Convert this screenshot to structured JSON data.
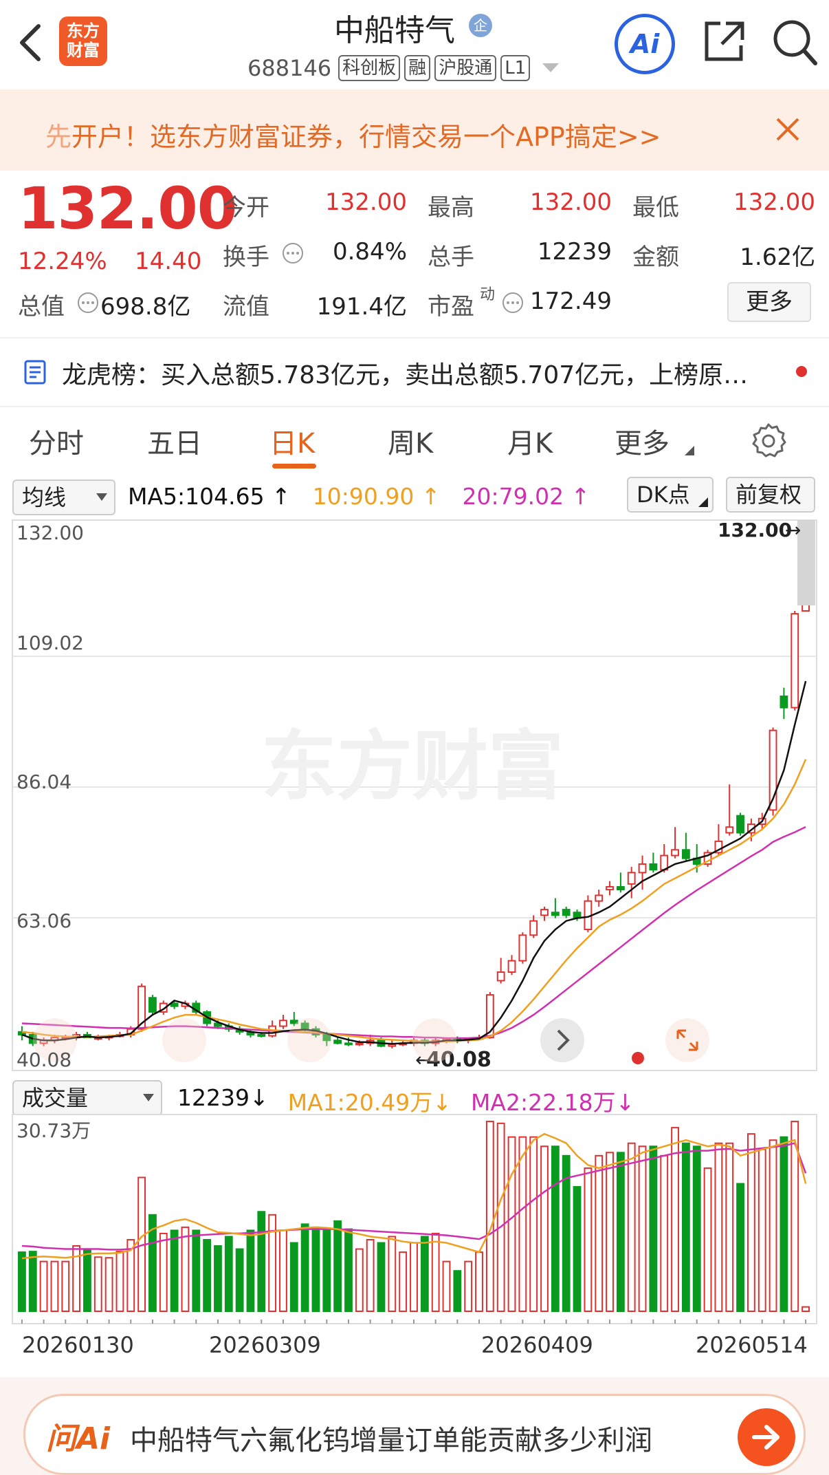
{
  "header": {
    "stock_name": "中船特气",
    "enterprise_badge": "企",
    "code": "688146",
    "tags": [
      "科创板",
      "融",
      "沪股通",
      "L1"
    ],
    "logo_line1": "东方",
    "logo_line2": "财富",
    "ai_button": "Ai"
  },
  "banner": {
    "first_char": "先",
    "text": "开户！选东方财富证券，行情交易一个APP搞定>>"
  },
  "quote": {
    "price": "132.00",
    "change_pct": "12.24%",
    "change_abs": "14.40",
    "open_label": "今开",
    "open": "132.00",
    "high_label": "最高",
    "high": "132.00",
    "low_label": "最低",
    "low": "132.00",
    "turnover_label": "换手",
    "turnover": "0.84%",
    "volume_label": "总手",
    "volume": "12239",
    "amount_label": "金额",
    "amount": "1.62亿",
    "mktcap_label": "总值",
    "mktcap": "698.8亿",
    "float_label": "流值",
    "float": "191.4亿",
    "pe_label": "市盈",
    "pe_sup": "动",
    "pe": "172.49",
    "more_button": "更多"
  },
  "dragon_tiger": {
    "text": "龙虎榜：买入总额5.783亿元，卖出总额5.707亿元，上榜原…"
  },
  "tabs": [
    "分时",
    "五日",
    "日K",
    "周K",
    "月K",
    "更多"
  ],
  "active_tab": "日K",
  "ma_bar": {
    "selector": "均线",
    "ma5": "MA5:104.65",
    "ma10": "10:90.90",
    "ma20": "20:79.02",
    "dk_button": "DK点",
    "adjust_button": "前复权"
  },
  "watermark": "东方财富",
  "price_axis": [
    "132.00",
    "109.02",
    "86.04",
    "63.06",
    "40.08"
  ],
  "last_price_marker": "132.00",
  "low_marker": "40.08",
  "vol_bar": {
    "selector": "成交量",
    "value": "12239",
    "ma1": "MA1:20.49万",
    "ma2": "MA2:22.18万",
    "max_label": "30.73万"
  },
  "dates": [
    "20260130",
    "20260309",
    "20260409",
    "20260514"
  ],
  "ask_ai": {
    "logo": "问Ai",
    "text": "中船特气六氟化钨增量订单能贡献多少利润"
  },
  "colors": {
    "up": "#e03131",
    "down": "#0a9a20",
    "ma5": "#111111",
    "ma10": "#f0a020",
    "ma20": "#d030b0",
    "accent": "#e8621a"
  },
  "chart_data": {
    "type": "candlestick",
    "ylim": [
      40.08,
      132.0
    ],
    "candles": [
      [
        43.0,
        44.0,
        41.5,
        42.5
      ],
      [
        42.5,
        43.0,
        40.5,
        41.0
      ],
      [
        41.0,
        42.0,
        40.5,
        41.5
      ],
      [
        41.5,
        42.5,
        41.0,
        42.0
      ],
      [
        42.0,
        42.5,
        41.5,
        42.0
      ],
      [
        42.0,
        43.0,
        41.5,
        42.5
      ],
      [
        42.5,
        43.0,
        42.0,
        42.0
      ],
      [
        42.0,
        42.5,
        41.5,
        42.0
      ],
      [
        42.0,
        42.5,
        41.5,
        42.2
      ],
      [
        42.2,
        43.0,
        42.0,
        42.5
      ],
      [
        42.5,
        44.0,
        42.0,
        43.5
      ],
      [
        43.5,
        51.5,
        43.0,
        51.0
      ],
      [
        49.0,
        49.5,
        46.0,
        46.5
      ],
      [
        46.5,
        48.5,
        46.0,
        48.0
      ],
      [
        48.0,
        48.5,
        47.0,
        47.5
      ],
      [
        47.5,
        48.5,
        47.0,
        48.0
      ],
      [
        48.0,
        48.5,
        46.0,
        46.5
      ],
      [
        46.5,
        46.8,
        44.0,
        44.5
      ],
      [
        44.5,
        45.0,
        43.5,
        44.0
      ],
      [
        44.0,
        44.5,
        43.0,
        43.5
      ],
      [
        43.5,
        44.0,
        42.5,
        43.0
      ],
      [
        43.0,
        43.5,
        42.0,
        42.5
      ],
      [
        42.5,
        43.0,
        42.0,
        42.3
      ],
      [
        42.3,
        45.0,
        42.0,
        44.0
      ],
      [
        44.0,
        46.0,
        43.5,
        45.0
      ],
      [
        45.0,
        46.5,
        44.0,
        44.5
      ],
      [
        44.5,
        45.0,
        43.0,
        43.5
      ],
      [
        43.5,
        44.0,
        42.0,
        42.5
      ],
      [
        42.5,
        43.0,
        40.5,
        41.5
      ],
      [
        41.5,
        42.0,
        40.8,
        41.0
      ],
      [
        41.0,
        42.0,
        40.5,
        40.8
      ],
      [
        40.8,
        41.5,
        40.5,
        41.0
      ],
      [
        41.0,
        42.5,
        40.5,
        41.5
      ],
      [
        41.5,
        42.0,
        40.3,
        40.5
      ],
      [
        40.5,
        41.5,
        40.1,
        40.8
      ],
      [
        40.8,
        41.5,
        40.5,
        41.0
      ],
      [
        41.0,
        42.0,
        40.5,
        41.5
      ],
      [
        41.5,
        42.0,
        40.5,
        41.0
      ],
      [
        41.0,
        42.0,
        40.5,
        41.5
      ],
      [
        41.5,
        42.0,
        41.0,
        41.8
      ],
      [
        41.8,
        42.2,
        41.0,
        41.5
      ],
      [
        41.5,
        42.0,
        41.0,
        41.8
      ],
      [
        41.8,
        42.5,
        41.5,
        42.0
      ],
      [
        42.0,
        50.0,
        41.8,
        49.5
      ],
      [
        52.0,
        56.0,
        51.5,
        53.5
      ],
      [
        53.5,
        56.5,
        53.0,
        55.5
      ],
      [
        55.5,
        60.5,
        55.0,
        60.0
      ],
      [
        60.0,
        63.5,
        59.5,
        62.5
      ],
      [
        63.5,
        65.0,
        62.5,
        64.5
      ],
      [
        64.0,
        66.5,
        63.0,
        63.5
      ],
      [
        64.5,
        65.0,
        63.0,
        63.5
      ],
      [
        64.0,
        64.5,
        62.5,
        63.0
      ],
      [
        61.0,
        67.0,
        60.5,
        66.0
      ],
      [
        66.0,
        68.0,
        65.0,
        67.0
      ],
      [
        68.0,
        69.5,
        67.0,
        68.5
      ],
      [
        68.5,
        71.0,
        67.5,
        68.0
      ],
      [
        69.0,
        72.0,
        66.5,
        71.0
      ],
      [
        71.0,
        74.0,
        68.0,
        72.5
      ],
      [
        72.5,
        74.5,
        71.0,
        71.5
      ],
      [
        71.5,
        76.0,
        71.0,
        74.0
      ],
      [
        74.0,
        79.0,
        73.5,
        75.0
      ],
      [
        75.0,
        78.0,
        73.0,
        73.5
      ],
      [
        73.5,
        76.0,
        71.0,
        72.5
      ],
      [
        72.5,
        75.0,
        72.0,
        74.5
      ],
      [
        74.5,
        79.5,
        74.0,
        76.5
      ],
      [
        78.0,
        86.5,
        77.5,
        79.0
      ],
      [
        81.0,
        81.5,
        77.5,
        78.0
      ],
      [
        78.0,
        80.5,
        76.5,
        79.5
      ],
      [
        79.5,
        81.5,
        78.5,
        80.5
      ],
      [
        82.0,
        96.5,
        81.0,
        96.0
      ],
      [
        102.0,
        103.5,
        98.0,
        100.0
      ],
      [
        100.0,
        117.0,
        99.5,
        116.5
      ],
      [
        117.0,
        132.0,
        117.0,
        132.0
      ]
    ],
    "ma5": [
      42.5,
      41.8,
      41.5,
      41.5,
      41.7,
      42.0,
      42.2,
      42.0,
      42.1,
      42.3,
      42.7,
      44.5,
      46.0,
      47.0,
      48.5,
      48.0,
      46.8,
      45.6,
      44.7,
      44.0,
      43.4,
      43.0,
      42.8,
      42.8,
      43.1,
      43.3,
      43.4,
      43.2,
      42.7,
      42.1,
      41.6,
      41.2,
      41.2,
      41.0,
      40.9,
      41.0,
      41.1,
      41.1,
      41.2,
      41.5,
      41.5,
      41.6,
      41.8,
      43.0,
      45.5,
      48.5,
      52.0,
      56.0,
      59.0,
      61.0,
      62.5,
      63.0,
      63.2,
      64.0,
      65.0,
      66.5,
      68.0,
      69.5,
      70.5,
      71.5,
      72.5,
      73.0,
      73.5,
      74.0,
      75.0,
      76.0,
      77.0,
      78.5,
      80.0,
      84.0,
      89.0,
      97.0,
      104.65
    ],
    "ma10": [
      43.0,
      42.8,
      42.5,
      42.3,
      42.2,
      42.1,
      42.1,
      42.2,
      42.3,
      42.4,
      42.5,
      43.2,
      44.0,
      44.8,
      45.5,
      46.0,
      46.0,
      45.6,
      45.2,
      44.8,
      44.3,
      43.9,
      43.5,
      43.3,
      43.2,
      43.1,
      43.0,
      42.9,
      42.7,
      42.5,
      42.3,
      42.1,
      41.9,
      41.7,
      41.6,
      41.5,
      41.4,
      41.3,
      41.3,
      41.3,
      41.4,
      41.5,
      41.6,
      42.2,
      43.2,
      44.7,
      46.6,
      48.7,
      51.0,
      53.3,
      55.6,
      57.7,
      59.6,
      61.5,
      62.7,
      63.6,
      64.7,
      66.0,
      67.5,
      69.0,
      70.0,
      71.0,
      72.0,
      73.0,
      74.0,
      75.0,
      76.0,
      77.3,
      78.6,
      80.5,
      83.0,
      86.5,
      90.9
    ],
    "ma20": [
      44.5,
      44.4,
      44.3,
      44.2,
      44.1,
      44.0,
      43.9,
      43.8,
      43.7,
      43.7,
      43.6,
      43.7,
      43.8,
      43.9,
      44.0,
      44.0,
      43.9,
      43.8,
      43.7,
      43.6,
      43.5,
      43.4,
      43.3,
      43.2,
      43.1,
      43.0,
      42.9,
      42.8,
      42.7,
      42.6,
      42.5,
      42.4,
      42.3,
      42.2,
      42.2,
      42.1,
      42.1,
      42.0,
      42.0,
      41.9,
      41.9,
      41.9,
      42.0,
      42.3,
      42.9,
      43.7,
      44.8,
      46.0,
      47.4,
      48.9,
      50.4,
      51.9,
      53.4,
      54.9,
      56.4,
      57.9,
      59.4,
      60.9,
      62.4,
      63.9,
      65.3,
      66.6,
      67.9,
      69.1,
      70.3,
      71.5,
      72.7,
      73.9,
      75.0,
      76.4,
      77.3,
      78.1,
      79.02
    ],
    "volume": [
      9.5,
      9.6,
      8.0,
      8.0,
      8.0,
      10.5,
      9.8,
      8.7,
      8.6,
      9.6,
      11.5,
      21.5,
      15.5,
      12.5,
      13.0,
      13.5,
      13.0,
      11.5,
      10.5,
      12.0,
      10.0,
      13.0,
      16.0,
      15.5,
      13.0,
      11.0,
      14.0,
      13.5,
      13.0,
      14.5,
      13.2,
      10.0,
      11.5,
      11.0,
      12.0,
      9.5,
      11.0,
      12.0,
      12.5,
      8.0,
      6.5,
      8.0,
      9.5,
      30.5,
      30.2,
      28.0,
      28.0,
      28.0,
      26.5,
      26.5,
      25.0,
      20.0,
      23.0,
      25.0,
      25.5,
      25.5,
      27.0,
      26.5,
      26.5,
      25.0,
      29.5,
      27.0,
      26.5,
      23.0,
      27.0,
      27.0,
      20.5,
      28.5,
      26.0,
      27.5,
      28.0,
      30.5,
      0.7
    ],
    "vol_ma1": [
      8.5,
      8.7,
      8.8,
      8.7,
      8.6,
      8.8,
      9.2,
      9.3,
      9.3,
      9.4,
      9.8,
      12.0,
      13.2,
      13.8,
      14.5,
      14.8,
      14.2,
      13.4,
      12.7,
      12.6,
      12.4,
      12.2,
      12.4,
      12.8,
      13.0,
      13.2,
      13.4,
      13.5,
      13.4,
      13.2,
      12.7,
      12.4,
      12.0,
      11.8,
      11.6,
      11.2,
      11.0,
      11.0,
      11.2,
      11.0,
      10.5,
      10.0,
      9.5,
      13.0,
      18.0,
      22.0,
      25.0,
      27.5,
      28.5,
      27.8,
      27.0,
      25.0,
      23.5,
      23.0,
      23.5,
      24.0,
      24.5,
      25.5,
      26.0,
      26.5,
      27.0,
      27.5,
      27.0,
      26.5,
      26.8,
      26.5,
      25.0,
      25.5,
      26.0,
      26.5,
      27.0,
      27.5,
      20.49
    ],
    "vol_ma2": [
      10.5,
      10.4,
      10.2,
      10.1,
      10.0,
      10.0,
      10.0,
      10.0,
      9.9,
      9.9,
      10.0,
      10.6,
      11.0,
      11.4,
      11.7,
      12.0,
      12.2,
      12.3,
      12.4,
      12.5,
      12.5,
      12.6,
      12.7,
      12.9,
      13.0,
      13.1,
      13.2,
      13.2,
      13.2,
      13.2,
      13.1,
      13.0,
      12.9,
      12.8,
      12.7,
      12.6,
      12.5,
      12.4,
      12.3,
      12.2,
      12.0,
      11.8,
      11.6,
      12.4,
      13.6,
      15.0,
      16.5,
      17.9,
      19.2,
      20.4,
      21.4,
      21.8,
      22.2,
      22.6,
      23.0,
      23.4,
      23.8,
      24.2,
      24.6,
      25.0,
      25.4,
      25.6,
      25.8,
      25.8,
      26.0,
      26.1,
      25.8,
      26.0,
      26.2,
      26.4,
      26.6,
      27.0,
      22.18
    ],
    "vol_ylim": [
      0,
      30.73
    ],
    "vol_unit": "万"
  }
}
